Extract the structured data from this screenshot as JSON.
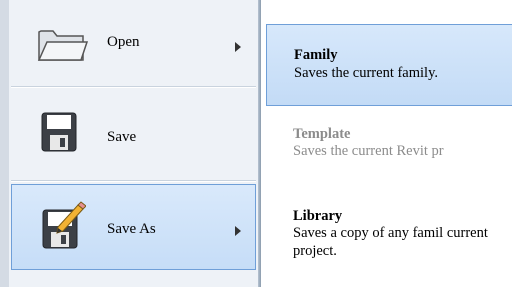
{
  "left_menu": {
    "items": [
      {
        "label": "Open",
        "icon": "folder-icon",
        "has_submenu": true,
        "selected": false
      },
      {
        "label": "Save",
        "icon": "floppy-disk-icon",
        "has_submenu": false,
        "selected": false
      },
      {
        "label": "Save As",
        "icon": "floppy-disk-pencil-icon",
        "has_submenu": true,
        "selected": true
      }
    ]
  },
  "submenu": {
    "items": [
      {
        "title": "Family",
        "description": "Saves the current family.",
        "state": "highlighted"
      },
      {
        "title": "Template",
        "description": "Saves the current Revit pr",
        "state": "disabled"
      },
      {
        "title": "Library",
        "description": "Saves a copy of any famil current project.",
        "state": "normal"
      }
    ]
  },
  "colors": {
    "highlight_fill": "#c8ddf7",
    "highlight_border": "#6f9fd8",
    "disabled_text": "#8c8c8c",
    "pane_background": "#eef2f7"
  }
}
